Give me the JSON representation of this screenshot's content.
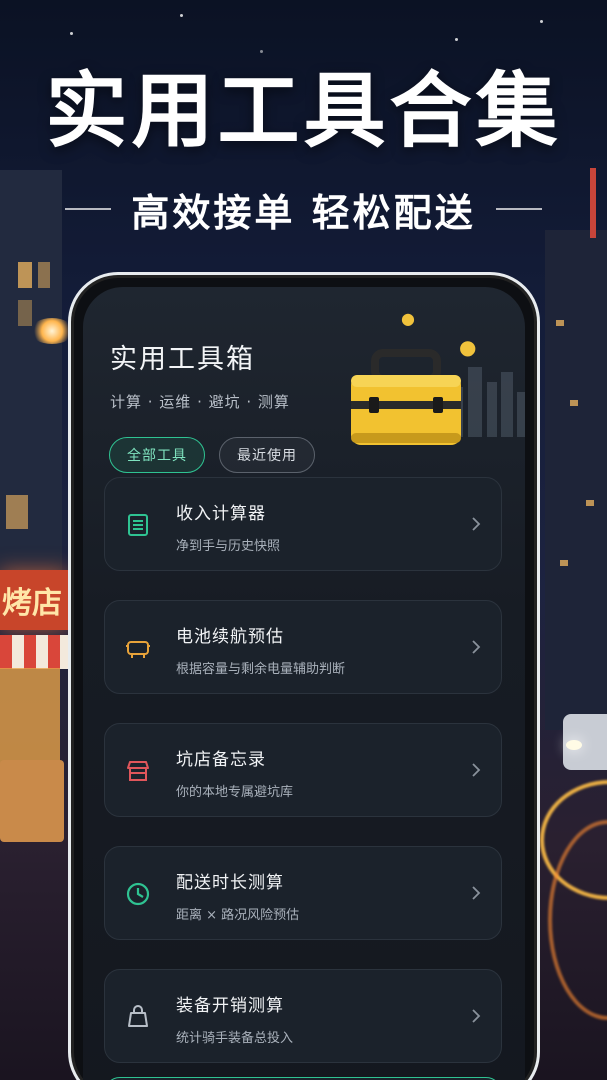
{
  "banner": {
    "headline": "实用工具合集",
    "subline": "高效接单 轻松配送"
  },
  "background": {
    "shop_sign": "烤店"
  },
  "app": {
    "title": "实用工具箱",
    "subtitle": "计算 · 运维 · 避坑 · 测算",
    "hero_icon": "toolbox-icon",
    "filters": [
      {
        "label": "全部工具",
        "selected": true
      },
      {
        "label": "最近使用",
        "selected": false
      }
    ],
    "tools": [
      {
        "title": "收入计算器",
        "desc": "净到手与历史快照",
        "icon": "document-list-icon",
        "color": "#2fc392"
      },
      {
        "title": "电池续航预估",
        "desc": "根据容量与剩余电量辅助判断",
        "icon": "battery-icon",
        "color": "#e8a33a"
      },
      {
        "title": "坑店备忘录",
        "desc": "你的本地专属避坑库",
        "icon": "store-icon",
        "color": "#e0565b"
      },
      {
        "title": "配送时长测算",
        "desc": "距离 × 路况风险预估",
        "icon": "clock-icon",
        "color": "#2fc392"
      },
      {
        "title": "装备开销测算",
        "desc": "统计骑手装备总投入",
        "icon": "shopping-bag-icon",
        "color": "#b8bfc8"
      }
    ]
  },
  "colors": {
    "accent": "#2fc392",
    "card_bg": "#1b222b",
    "screen_bg": "#171c24"
  }
}
